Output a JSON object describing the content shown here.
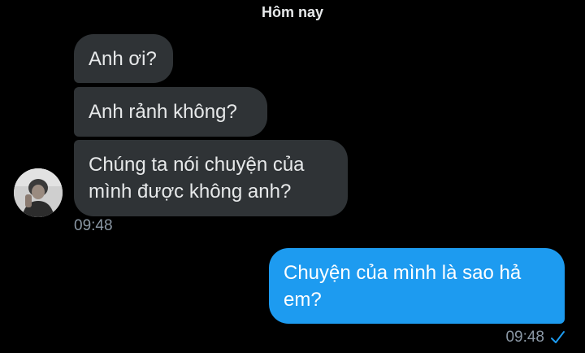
{
  "date_separator": "Hôm nay",
  "incoming": {
    "messages": [
      "Anh ơi?",
      "Anh rảnh không?",
      "Chúng ta nói chuyện của mình được không anh?"
    ],
    "time": "09:48",
    "bubble_color": "#2f3336"
  },
  "outgoing": {
    "message": "Chuyện của mình là sao hả em?",
    "time": "09:48",
    "status_icon": "checkmark-icon",
    "bubble_color": "#1d9bf0"
  }
}
